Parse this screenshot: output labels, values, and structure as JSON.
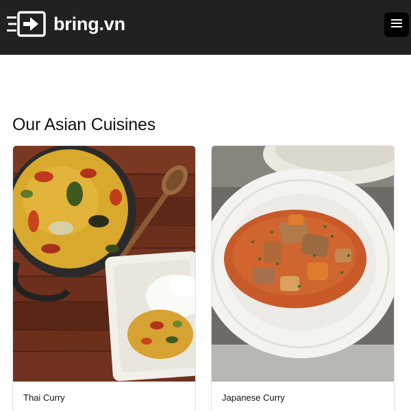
{
  "header": {
    "brand_name": "bring.vn",
    "logo_icon": "arrow-into-box-icon",
    "menu_icon": "hamburger-menu-icon"
  },
  "section": {
    "title": "Our Asian Cuisines"
  },
  "cards": [
    {
      "title": "Thai Curry",
      "image": "thai-curry-photo"
    },
    {
      "title": "Japanese Curry",
      "image": "japanese-curry-photo"
    }
  ],
  "colors": {
    "navbar": "#212121",
    "menu_button": "#000000",
    "text": "#111111",
    "card_border": "#e2e2e2"
  }
}
